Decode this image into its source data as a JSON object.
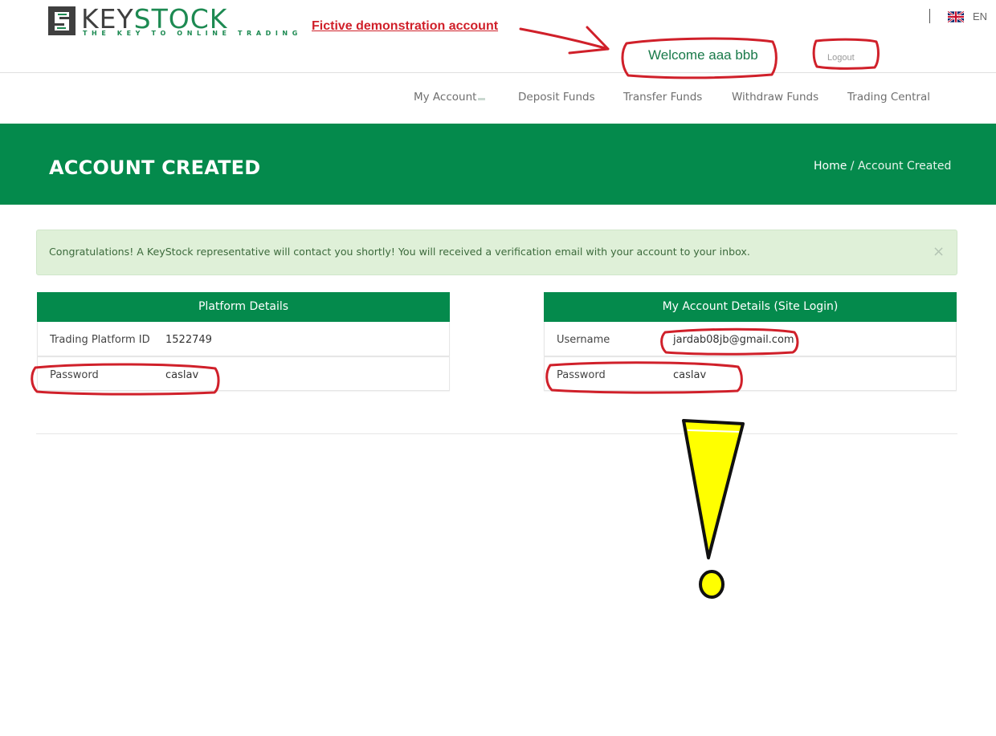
{
  "header": {
    "logo": {
      "word_left": "KEY",
      "word_right": "STOCK",
      "tagline": "THE KEY TO ONLINE TRADING"
    },
    "annotation_title": "Fictive demonstration account",
    "welcome_text": "Welcome aaa bbb",
    "logout_label": "Logout",
    "language": {
      "code": "EN",
      "flag_icon": "uk-flag-icon"
    }
  },
  "nav": {
    "items": [
      {
        "label": "My Account",
        "has_submenu": true
      },
      {
        "label": "Deposit Funds"
      },
      {
        "label": "Transfer Funds"
      },
      {
        "label": "Withdraw Funds"
      },
      {
        "label": "Trading Central"
      }
    ]
  },
  "banner": {
    "title": "ACCOUNT CREATED",
    "breadcrumb": {
      "home": "Home",
      "separator": " / ",
      "current": "Account Created"
    }
  },
  "alert": {
    "text": "Congratulations! A KeyStock representative will contact you shortly! You will received a verification email with your account to your inbox.",
    "close_glyph": "×"
  },
  "platform_details": {
    "title": "Platform Details",
    "rows": [
      {
        "label": "Trading Platform ID",
        "value": "1522749"
      },
      {
        "label": "Password",
        "value": "caslav"
      }
    ]
  },
  "account_details": {
    "title": "My Account Details (Site Login)",
    "rows": [
      {
        "label": "Username",
        "value": "jardab08jb@gmail.com"
      },
      {
        "label": "Password",
        "value": "caslav"
      }
    ]
  },
  "colors": {
    "brand_green": "#048a4c",
    "annotation_red": "#d0202a",
    "exclamation_yellow": "#ffff00"
  }
}
